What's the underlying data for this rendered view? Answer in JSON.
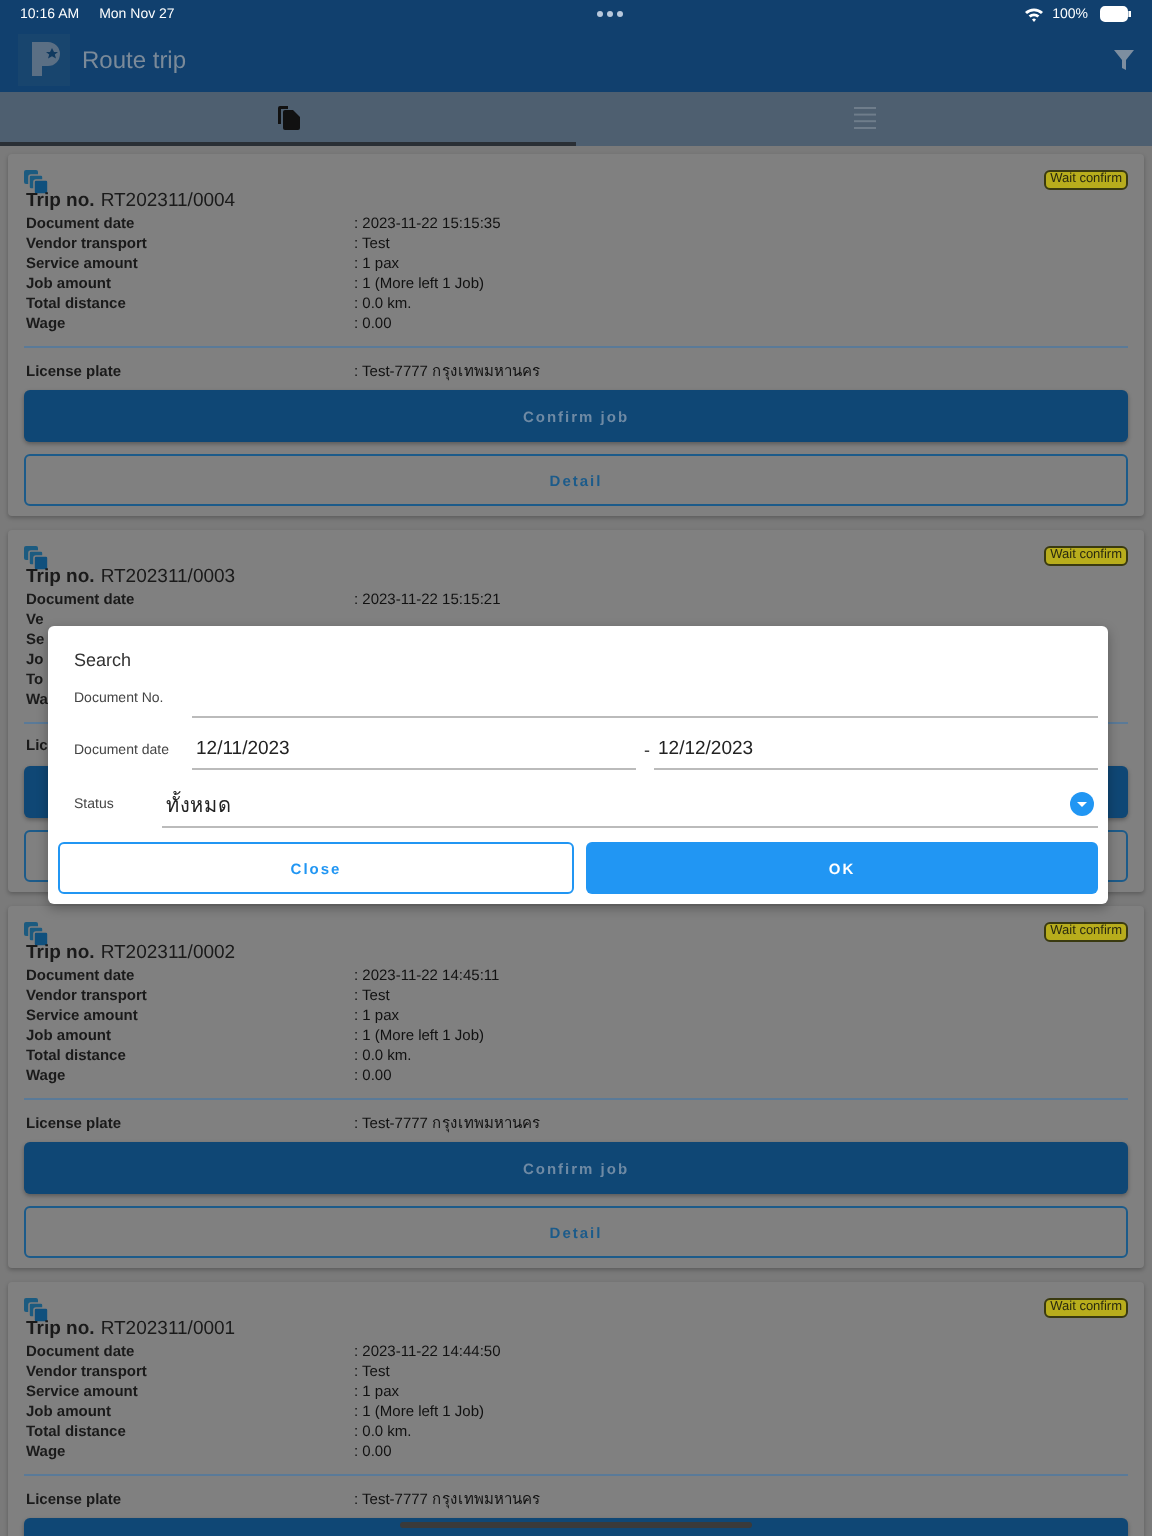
{
  "status_bar": {
    "time": "10:16 AM",
    "date": "Mon Nov 27",
    "battery": "100%"
  },
  "header": {
    "title": "Route trip"
  },
  "tabs": [
    {
      "kind": "documents",
      "selected": true
    },
    {
      "kind": "list",
      "selected": false
    }
  ],
  "trips": [
    {
      "trip_label": "Trip no.",
      "trip_no": "RT202311/0004",
      "status": "Wait confirm",
      "rows": [
        {
          "label": "Document date",
          "value": ": 2023-11-22 15:15:35"
        },
        {
          "label": "Vendor transport",
          "value": ": Test"
        },
        {
          "label": "Service amount",
          "value": ": 1 pax"
        },
        {
          "label": "Job amount",
          "value": ": 1 (More left 1 Job)"
        },
        {
          "label": "Total distance",
          "value": ": 0.0 km."
        },
        {
          "label": "Wage",
          "value": ": 0.00"
        }
      ],
      "license": {
        "label": "License plate",
        "value": ": Test-7777 กรุงเทพมหานคร"
      },
      "buttons": [
        {
          "kind": "confirm",
          "label": "Confirm job"
        },
        {
          "kind": "detail",
          "label": "Detail"
        }
      ]
    },
    {
      "trip_label": "Trip no.",
      "trip_no": "RT202311/0003",
      "status": "Wait confirm",
      "rows": [
        {
          "label": "Document date",
          "value": ": 2023-11-22 15:15:21"
        },
        {
          "label": "Ve"
        },
        {
          "label": "Se"
        },
        {
          "label": "Jo"
        },
        {
          "label": "To"
        },
        {
          "label": "Wa"
        }
      ],
      "license": {
        "label": "Lic"
      },
      "buttons": [
        {
          "kind": "confirm"
        },
        {
          "kind": "detail"
        }
      ]
    },
    {
      "trip_label": "Trip no.",
      "trip_no": "RT202311/0002",
      "status": "Wait confirm",
      "rows": [
        {
          "label": "Document date",
          "value": ": 2023-11-22 14:45:11"
        },
        {
          "label": "Vendor transport",
          "value": ": Test"
        },
        {
          "label": "Service amount",
          "value": ": 1 pax"
        },
        {
          "label": "Job amount",
          "value": ": 1 (More left 1 Job)"
        },
        {
          "label": "Total distance",
          "value": ": 0.0 km."
        },
        {
          "label": "Wage",
          "value": ": 0.00"
        }
      ],
      "license": {
        "label": "License plate",
        "value": ": Test-7777 กรุงเทพมหานคร"
      },
      "buttons": [
        {
          "kind": "confirm",
          "label": "Confirm job"
        },
        {
          "kind": "detail",
          "label": "Detail"
        }
      ]
    },
    {
      "trip_label": "Trip no.",
      "trip_no": "RT202311/0001",
      "status": "Wait confirm",
      "rows": [
        {
          "label": "Document date",
          "value": ": 2023-11-22 14:44:50"
        },
        {
          "label": "Vendor transport",
          "value": ": Test"
        },
        {
          "label": "Service amount",
          "value": ": 1 pax"
        },
        {
          "label": "Job amount",
          "value": ": 1 (More left 1 Job)"
        },
        {
          "label": "Total distance",
          "value": ": 0.0 km."
        },
        {
          "label": "Wage",
          "value": ": 0.00"
        }
      ],
      "license": {
        "label": "License plate",
        "value": ": Test-7777 กรุงเทพมหานคร"
      },
      "buttons": [
        {
          "kind": "confirm"
        }
      ]
    }
  ],
  "dialog": {
    "title": "Search",
    "document_no": {
      "label": "Document No."
    },
    "document_date": {
      "label": "Document date",
      "from": "12/11/2023",
      "separator": "-",
      "to": "12/12/2023"
    },
    "status": {
      "label": "Status",
      "value": "ทั้งหมด"
    },
    "close": "Close",
    "ok": "OK"
  }
}
